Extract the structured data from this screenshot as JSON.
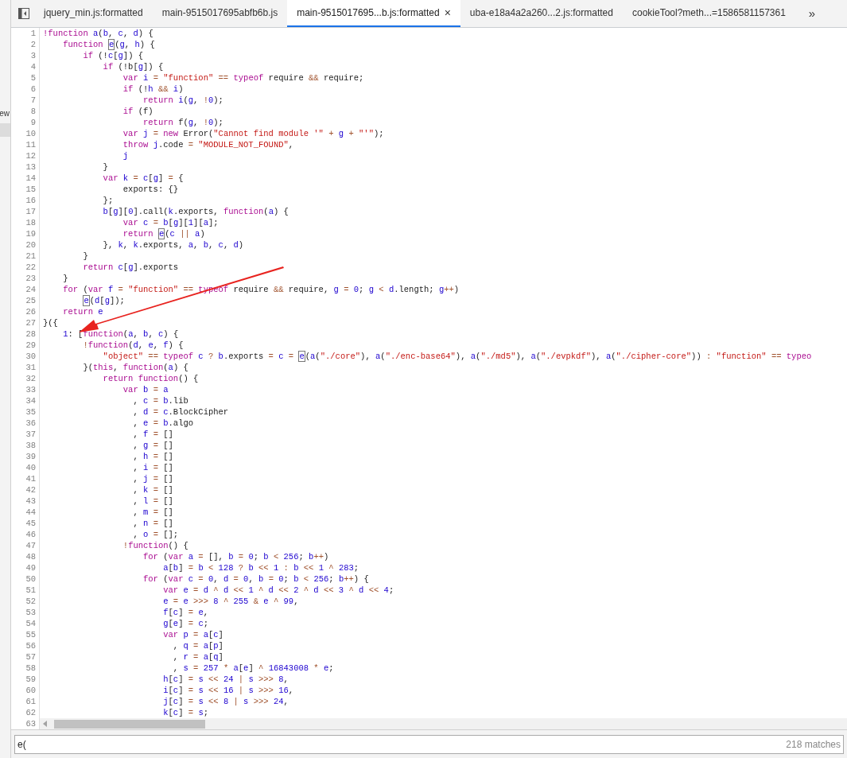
{
  "sidebar": {
    "label": "ew"
  },
  "tabs": [
    {
      "label": "jquery_min.js:formatted",
      "selected": false
    },
    {
      "label": "main-9515017695abfb6b.js",
      "selected": false
    },
    {
      "label": "main-9515017695...b.js:formatted",
      "selected": true
    },
    {
      "label": "uba-e18a4a2a260...2.js:formatted",
      "selected": false
    },
    {
      "label": "cookieTool?meth...=1586581157361",
      "selected": false
    }
  ],
  "tab_close": "×",
  "tab_overflow": "»",
  "lines": [
    {
      "number": "1",
      "tokens": [
        {
          "kind": "kw",
          "text": "!function"
        },
        {
          "kind": "var",
          "text": " a"
        },
        {
          "kind": "plain",
          "text": "("
        },
        {
          "kind": "var",
          "text": "b"
        },
        {
          "kind": "plain",
          "text": ","
        },
        {
          "kind": "var",
          "text": " c"
        },
        {
          "kind": "plain",
          "text": ","
        },
        {
          "kind": "var",
          "text": " d"
        },
        {
          "kind": "plain",
          "text": ") {"
        }
      ]
    },
    {
      "number": "2",
      "tokens": [
        {
          "kind": "kw",
          "text": "    function "
        },
        {
          "kind": "match",
          "text": "e"
        },
        {
          "kind": "plain",
          "text": "("
        },
        {
          "kind": "var",
          "text": "g"
        },
        {
          "kind": "plain",
          "text": ","
        },
        {
          "kind": "var",
          "text": " h"
        },
        {
          "kind": "plain",
          "text": ") {"
        }
      ]
    },
    {
      "number": "3",
      "tokens": [
        {
          "kind": "kw",
          "text": "        if"
        },
        {
          "kind": "plain",
          "text": " (!"
        },
        {
          "kind": "var",
          "text": "c"
        },
        {
          "kind": "plain",
          "text": "["
        },
        {
          "kind": "var",
          "text": "g"
        },
        {
          "kind": "plain",
          "text": "]) {"
        }
      ]
    },
    {
      "number": "4",
      "tokens": [
        {
          "kind": "kw",
          "text": "            if"
        },
        {
          "kind": "plain",
          "text": " (!b["
        },
        {
          "kind": "var",
          "text": "g"
        },
        {
          "kind": "plain",
          "text": "]) {"
        }
      ]
    },
    {
      "number": "5",
      "tokens": [
        {
          "kind": "kw",
          "text": "                var"
        },
        {
          "kind": "var",
          "text": " i"
        },
        {
          "kind": "op",
          "text": " ="
        },
        {
          "kind": "str",
          "text": " \"function\""
        },
        {
          "kind": "op",
          "text": " =="
        },
        {
          "kind": "kw",
          "text": " typeof"
        },
        {
          "kind": "plain",
          "text": " require"
        },
        {
          "kind": "op",
          "text": " &&"
        },
        {
          "kind": "plain",
          "text": " require;"
        }
      ]
    },
    {
      "number": "6",
      "tokens": [
        {
          "kind": "kw",
          "text": "                if"
        },
        {
          "kind": "plain",
          "text": " (!"
        },
        {
          "kind": "var",
          "text": "h"
        },
        {
          "kind": "op",
          "text": " &&"
        },
        {
          "kind": "var",
          "text": " i"
        },
        {
          "kind": "plain",
          "text": ")"
        }
      ]
    },
    {
      "number": "7",
      "tokens": [
        {
          "kind": "kw",
          "text": "                    return"
        },
        {
          "kind": "var",
          "text": " i"
        },
        {
          "kind": "plain",
          "text": "("
        },
        {
          "kind": "var",
          "text": "g"
        },
        {
          "kind": "plain",
          "text": ","
        },
        {
          "kind": "op",
          "text": " !"
        },
        {
          "kind": "num",
          "text": "0"
        },
        {
          "kind": "plain",
          "text": ");"
        }
      ]
    },
    {
      "number": "8",
      "tokens": [
        {
          "kind": "kw",
          "text": "                if"
        },
        {
          "kind": "plain",
          "text": " (f)"
        }
      ]
    },
    {
      "number": "9",
      "tokens": [
        {
          "kind": "kw",
          "text": "                    return"
        },
        {
          "kind": "plain",
          "text": " f("
        },
        {
          "kind": "var",
          "text": "g"
        },
        {
          "kind": "plain",
          "text": ","
        },
        {
          "kind": "op",
          "text": " !"
        },
        {
          "kind": "num",
          "text": "0"
        },
        {
          "kind": "plain",
          "text": ");"
        }
      ]
    },
    {
      "number": "10",
      "tokens": [
        {
          "kind": "kw",
          "text": "                var"
        },
        {
          "kind": "var",
          "text": " j"
        },
        {
          "kind": "op",
          "text": " ="
        },
        {
          "kind": "kw",
          "text": " new"
        },
        {
          "kind": "plain",
          "text": " Error("
        },
        {
          "kind": "str",
          "text": "\"Cannot find module '\""
        },
        {
          "kind": "op",
          "text": " +"
        },
        {
          "kind": "var",
          "text": " g"
        },
        {
          "kind": "op",
          "text": " +"
        },
        {
          "kind": "str",
          "text": " \"'\""
        },
        {
          "kind": "plain",
          "text": ");"
        }
      ]
    },
    {
      "number": "11",
      "tokens": [
        {
          "kind": "kw",
          "text": "                throw"
        },
        {
          "kind": "var",
          "text": " j"
        },
        {
          "kind": "plain",
          "text": ".code"
        },
        {
          "kind": "op",
          "text": " ="
        },
        {
          "kind": "str",
          "text": " \"MODULE_NOT_FOUND\""
        },
        {
          "kind": "plain",
          "text": ","
        }
      ]
    },
    {
      "number": "12",
      "tokens": [
        {
          "kind": "var",
          "text": "                j"
        }
      ]
    },
    {
      "number": "13",
      "tokens": [
        {
          "kind": "plain",
          "text": "            }"
        }
      ]
    },
    {
      "number": "14",
      "tokens": [
        {
          "kind": "kw",
          "text": "            var"
        },
        {
          "kind": "var",
          "text": " k"
        },
        {
          "kind": "op",
          "text": " ="
        },
        {
          "kind": "var",
          "text": " c"
        },
        {
          "kind": "plain",
          "text": "["
        },
        {
          "kind": "var",
          "text": "g"
        },
        {
          "kind": "plain",
          "text": "]"
        },
        {
          "kind": "op",
          "text": " ="
        },
        {
          "kind": "plain",
          "text": " {"
        }
      ]
    },
    {
      "number": "15",
      "tokens": [
        {
          "kind": "plain",
          "text": "                exports: {}"
        }
      ]
    },
    {
      "number": "16",
      "tokens": [
        {
          "kind": "plain",
          "text": "            };"
        }
      ]
    },
    {
      "number": "17",
      "tokens": [
        {
          "kind": "var",
          "text": "            b"
        },
        {
          "kind": "plain",
          "text": "["
        },
        {
          "kind": "var",
          "text": "g"
        },
        {
          "kind": "plain",
          "text": "]["
        },
        {
          "kind": "num",
          "text": "0"
        },
        {
          "kind": "plain",
          "text": "].call("
        },
        {
          "kind": "var",
          "text": "k"
        },
        {
          "kind": "plain",
          "text": ".exports,"
        },
        {
          "kind": "kw",
          "text": " function"
        },
        {
          "kind": "plain",
          "text": "("
        },
        {
          "kind": "var",
          "text": "a"
        },
        {
          "kind": "plain",
          "text": ") {"
        }
      ]
    },
    {
      "number": "18",
      "tokens": [
        {
          "kind": "kw",
          "text": "                var"
        },
        {
          "kind": "var",
          "text": " c"
        },
        {
          "kind": "op",
          "text": " ="
        },
        {
          "kind": "var",
          "text": " b"
        },
        {
          "kind": "plain",
          "text": "["
        },
        {
          "kind": "var",
          "text": "g"
        },
        {
          "kind": "plain",
          "text": "]["
        },
        {
          "kind": "num",
          "text": "1"
        },
        {
          "kind": "plain",
          "text": "]["
        },
        {
          "kind": "var",
          "text": "a"
        },
        {
          "kind": "plain",
          "text": "];"
        }
      ]
    },
    {
      "number": "19",
      "tokens": [
        {
          "kind": "kw",
          "text": "                return "
        },
        {
          "kind": "match",
          "text": "e"
        },
        {
          "kind": "plain",
          "text": "("
        },
        {
          "kind": "var",
          "text": "c"
        },
        {
          "kind": "op",
          "text": " ||"
        },
        {
          "kind": "var",
          "text": " a"
        },
        {
          "kind": "plain",
          "text": ")"
        }
      ]
    },
    {
      "number": "20",
      "tokens": [
        {
          "kind": "plain",
          "text": "            },"
        },
        {
          "kind": "var",
          "text": " k"
        },
        {
          "kind": "plain",
          "text": ","
        },
        {
          "kind": "var",
          "text": " k"
        },
        {
          "kind": "plain",
          "text": ".exports,"
        },
        {
          "kind": "var",
          "text": " a"
        },
        {
          "kind": "plain",
          "text": ","
        },
        {
          "kind": "var",
          "text": " b"
        },
        {
          "kind": "plain",
          "text": ","
        },
        {
          "kind": "var",
          "text": " c"
        },
        {
          "kind": "plain",
          "text": ","
        },
        {
          "kind": "var",
          "text": " d"
        },
        {
          "kind": "plain",
          "text": ")"
        }
      ]
    },
    {
      "number": "21",
      "tokens": [
        {
          "kind": "plain",
          "text": "        }"
        }
      ]
    },
    {
      "number": "22",
      "tokens": [
        {
          "kind": "kw",
          "text": "        return"
        },
        {
          "kind": "var",
          "text": " c"
        },
        {
          "kind": "plain",
          "text": "["
        },
        {
          "kind": "var",
          "text": "g"
        },
        {
          "kind": "plain",
          "text": "].exports"
        }
      ]
    },
    {
      "number": "23",
      "tokens": [
        {
          "kind": "plain",
          "text": "    }"
        }
      ]
    },
    {
      "number": "24",
      "tokens": [
        {
          "kind": "kw",
          "text": "    for"
        },
        {
          "kind": "plain",
          "text": " ("
        },
        {
          "kind": "kw",
          "text": "var"
        },
        {
          "kind": "var",
          "text": " f"
        },
        {
          "kind": "op",
          "text": " ="
        },
        {
          "kind": "str",
          "text": " \"function\""
        },
        {
          "kind": "op",
          "text": " =="
        },
        {
          "kind": "kw",
          "text": " typeof"
        },
        {
          "kind": "plain",
          "text": " require"
        },
        {
          "kind": "op",
          "text": " &&"
        },
        {
          "kind": "plain",
          "text": " require,"
        },
        {
          "kind": "var",
          "text": " g"
        },
        {
          "kind": "op",
          "text": " ="
        },
        {
          "kind": "num",
          "text": " 0"
        },
        {
          "kind": "plain",
          "text": ";"
        },
        {
          "kind": "var",
          "text": " g"
        },
        {
          "kind": "op",
          "text": " <"
        },
        {
          "kind": "var",
          "text": " d"
        },
        {
          "kind": "plain",
          "text": ".length;"
        },
        {
          "kind": "var",
          "text": " g"
        },
        {
          "kind": "op",
          "text": "++"
        },
        {
          "kind": "plain",
          "text": ")"
        }
      ]
    },
    {
      "number": "25",
      "tokens": [
        {
          "kind": "match",
          "text": "        e"
        },
        {
          "kind": "plain",
          "text": "("
        },
        {
          "kind": "var",
          "text": "d"
        },
        {
          "kind": "plain",
          "text": "["
        },
        {
          "kind": "var",
          "text": "g"
        },
        {
          "kind": "plain",
          "text": "]);"
        }
      ]
    },
    {
      "number": "26",
      "tokens": [
        {
          "kind": "kw",
          "text": "    return"
        },
        {
          "kind": "var",
          "text": " e"
        }
      ]
    },
    {
      "number": "27",
      "tokens": [
        {
          "kind": "plain",
          "text": "}({"
        }
      ]
    },
    {
      "number": "28",
      "tokens": [
        {
          "kind": "num",
          "text": "    1"
        },
        {
          "kind": "plain",
          "text": ": ["
        },
        {
          "kind": "kw",
          "text": "function"
        },
        {
          "kind": "plain",
          "text": "("
        },
        {
          "kind": "var",
          "text": "a"
        },
        {
          "kind": "plain",
          "text": ","
        },
        {
          "kind": "var",
          "text": " b"
        },
        {
          "kind": "plain",
          "text": ","
        },
        {
          "kind": "var",
          "text": " c"
        },
        {
          "kind": "plain",
          "text": ") {"
        }
      ]
    },
    {
      "number": "29",
      "tokens": [
        {
          "kind": "op",
          "text": "        !"
        },
        {
          "kind": "kw",
          "text": "function"
        },
        {
          "kind": "plain",
          "text": "("
        },
        {
          "kind": "var",
          "text": "d"
        },
        {
          "kind": "plain",
          "text": ","
        },
        {
          "kind": "var",
          "text": " e"
        },
        {
          "kind": "plain",
          "text": ","
        },
        {
          "kind": "var",
          "text": " f"
        },
        {
          "kind": "plain",
          "text": ") {"
        }
      ]
    },
    {
      "number": "30",
      "tokens": [
        {
          "kind": "str",
          "text": "            \"object\""
        },
        {
          "kind": "op",
          "text": " =="
        },
        {
          "kind": "kw",
          "text": " typeof"
        },
        {
          "kind": "var",
          "text": " c"
        },
        {
          "kind": "op",
          "text": " ?"
        },
        {
          "kind": "var",
          "text": " b"
        },
        {
          "kind": "plain",
          "text": ".exports"
        },
        {
          "kind": "op",
          "text": " ="
        },
        {
          "kind": "var",
          "text": " c"
        },
        {
          "kind": "op",
          "text": " = "
        },
        {
          "kind": "match",
          "text": "e"
        },
        {
          "kind": "plain",
          "text": "("
        },
        {
          "kind": "var",
          "text": "a"
        },
        {
          "kind": "plain",
          "text": "("
        },
        {
          "kind": "str",
          "text": "\"./core\""
        },
        {
          "kind": "plain",
          "text": "),"
        },
        {
          "kind": "var",
          "text": " a"
        },
        {
          "kind": "plain",
          "text": "("
        },
        {
          "kind": "str",
          "text": "\"./enc-base64\""
        },
        {
          "kind": "plain",
          "text": "),"
        },
        {
          "kind": "var",
          "text": " a"
        },
        {
          "kind": "plain",
          "text": "("
        },
        {
          "kind": "str",
          "text": "\"./md5\""
        },
        {
          "kind": "plain",
          "text": "),"
        },
        {
          "kind": "var",
          "text": " a"
        },
        {
          "kind": "plain",
          "text": "("
        },
        {
          "kind": "str",
          "text": "\"./evpkdf\""
        },
        {
          "kind": "plain",
          "text": "),"
        },
        {
          "kind": "var",
          "text": " a"
        },
        {
          "kind": "plain",
          "text": "("
        },
        {
          "kind": "str",
          "text": "\"./cipher-core\""
        },
        {
          "kind": "plain",
          "text": "))"
        },
        {
          "kind": "op",
          "text": " :"
        },
        {
          "kind": "str",
          "text": " \"function\""
        },
        {
          "kind": "op",
          "text": " =="
        },
        {
          "kind": "kw",
          "text": " typeo"
        }
      ]
    },
    {
      "number": "31",
      "tokens": [
        {
          "kind": "plain",
          "text": "        }("
        },
        {
          "kind": "kw",
          "text": "this"
        },
        {
          "kind": "plain",
          "text": ","
        },
        {
          "kind": "kw",
          "text": " function"
        },
        {
          "kind": "plain",
          "text": "("
        },
        {
          "kind": "var",
          "text": "a"
        },
        {
          "kind": "plain",
          "text": ") {"
        }
      ]
    },
    {
      "number": "32",
      "tokens": [
        {
          "kind": "kw",
          "text": "            return function"
        },
        {
          "kind": "plain",
          "text": "() {"
        }
      ]
    },
    {
      "number": "33",
      "tokens": [
        {
          "kind": "kw",
          "text": "                var"
        },
        {
          "kind": "var",
          "text": " b"
        },
        {
          "kind": "op",
          "text": " ="
        },
        {
          "kind": "var",
          "text": " a"
        }
      ]
    },
    {
      "number": "34",
      "tokens": [
        {
          "kind": "plain",
          "text": "                  ,"
        },
        {
          "kind": "var",
          "text": " c"
        },
        {
          "kind": "op",
          "text": " ="
        },
        {
          "kind": "var",
          "text": " b"
        },
        {
          "kind": "plain",
          "text": ".lib"
        }
      ]
    },
    {
      "number": "35",
      "tokens": [
        {
          "kind": "plain",
          "text": "                  ,"
        },
        {
          "kind": "var",
          "text": " d"
        },
        {
          "kind": "op",
          "text": " ="
        },
        {
          "kind": "var",
          "text": " c"
        },
        {
          "kind": "plain",
          "text": ".BlockCipher"
        }
      ]
    },
    {
      "number": "36",
      "tokens": [
        {
          "kind": "plain",
          "text": "                  ,"
        },
        {
          "kind": "var",
          "text": " e"
        },
        {
          "kind": "op",
          "text": " ="
        },
        {
          "kind": "var",
          "text": " b"
        },
        {
          "kind": "plain",
          "text": ".algo"
        }
      ]
    },
    {
      "number": "37",
      "tokens": [
        {
          "kind": "plain",
          "text": "                  ,"
        },
        {
          "kind": "var",
          "text": " f"
        },
        {
          "kind": "op",
          "text": " ="
        },
        {
          "kind": "plain",
          "text": " []"
        }
      ]
    },
    {
      "number": "38",
      "tokens": [
        {
          "kind": "plain",
          "text": "                  ,"
        },
        {
          "kind": "var",
          "text": " g"
        },
        {
          "kind": "op",
          "text": " ="
        },
        {
          "kind": "plain",
          "text": " []"
        }
      ]
    },
    {
      "number": "39",
      "tokens": [
        {
          "kind": "plain",
          "text": "                  ,"
        },
        {
          "kind": "var",
          "text": " h"
        },
        {
          "kind": "op",
          "text": " ="
        },
        {
          "kind": "plain",
          "text": " []"
        }
      ]
    },
    {
      "number": "40",
      "tokens": [
        {
          "kind": "plain",
          "text": "                  ,"
        },
        {
          "kind": "var",
          "text": " i"
        },
        {
          "kind": "op",
          "text": " ="
        },
        {
          "kind": "plain",
          "text": " []"
        }
      ]
    },
    {
      "number": "41",
      "tokens": [
        {
          "kind": "plain",
          "text": "                  ,"
        },
        {
          "kind": "var",
          "text": " j"
        },
        {
          "kind": "op",
          "text": " ="
        },
        {
          "kind": "plain",
          "text": " []"
        }
      ]
    },
    {
      "number": "42",
      "tokens": [
        {
          "kind": "plain",
          "text": "                  ,"
        },
        {
          "kind": "var",
          "text": " k"
        },
        {
          "kind": "op",
          "text": " ="
        },
        {
          "kind": "plain",
          "text": " []"
        }
      ]
    },
    {
      "number": "43",
      "tokens": [
        {
          "kind": "plain",
          "text": "                  ,"
        },
        {
          "kind": "var",
          "text": " l"
        },
        {
          "kind": "op",
          "text": " ="
        },
        {
          "kind": "plain",
          "text": " []"
        }
      ]
    },
    {
      "number": "44",
      "tokens": [
        {
          "kind": "plain",
          "text": "                  ,"
        },
        {
          "kind": "var",
          "text": " m"
        },
        {
          "kind": "op",
          "text": " ="
        },
        {
          "kind": "plain",
          "text": " []"
        }
      ]
    },
    {
      "number": "45",
      "tokens": [
        {
          "kind": "plain",
          "text": "                  ,"
        },
        {
          "kind": "var",
          "text": " n"
        },
        {
          "kind": "op",
          "text": " ="
        },
        {
          "kind": "plain",
          "text": " []"
        }
      ]
    },
    {
      "number": "46",
      "tokens": [
        {
          "kind": "plain",
          "text": "                  ,"
        },
        {
          "kind": "var",
          "text": " o"
        },
        {
          "kind": "op",
          "text": " ="
        },
        {
          "kind": "plain",
          "text": " [];"
        }
      ]
    },
    {
      "number": "47",
      "tokens": [
        {
          "kind": "op",
          "text": "                !"
        },
        {
          "kind": "kw",
          "text": "function"
        },
        {
          "kind": "plain",
          "text": "() {"
        }
      ]
    },
    {
      "number": "48",
      "tokens": [
        {
          "kind": "kw",
          "text": "                    for"
        },
        {
          "kind": "plain",
          "text": " ("
        },
        {
          "kind": "kw",
          "text": "var"
        },
        {
          "kind": "var",
          "text": " a"
        },
        {
          "kind": "op",
          "text": " ="
        },
        {
          "kind": "plain",
          "text": " [],"
        },
        {
          "kind": "var",
          "text": " b"
        },
        {
          "kind": "op",
          "text": " ="
        },
        {
          "kind": "num",
          "text": " 0"
        },
        {
          "kind": "plain",
          "text": ";"
        },
        {
          "kind": "var",
          "text": " b"
        },
        {
          "kind": "op",
          "text": " <"
        },
        {
          "kind": "num",
          "text": " 256"
        },
        {
          "kind": "plain",
          "text": ";"
        },
        {
          "kind": "var",
          "text": " b"
        },
        {
          "kind": "op",
          "text": "++"
        },
        {
          "kind": "plain",
          "text": ")"
        }
      ]
    },
    {
      "number": "49",
      "tokens": [
        {
          "kind": "var",
          "text": "                        a"
        },
        {
          "kind": "plain",
          "text": "["
        },
        {
          "kind": "var",
          "text": "b"
        },
        {
          "kind": "plain",
          "text": "]"
        },
        {
          "kind": "op",
          "text": " ="
        },
        {
          "kind": "var",
          "text": " b"
        },
        {
          "kind": "op",
          "text": " <"
        },
        {
          "kind": "num",
          "text": " 128"
        },
        {
          "kind": "op",
          "text": " ?"
        },
        {
          "kind": "var",
          "text": " b"
        },
        {
          "kind": "op",
          "text": " <<"
        },
        {
          "kind": "num",
          "text": " 1"
        },
        {
          "kind": "op",
          "text": " :"
        },
        {
          "kind": "var",
          "text": " b"
        },
        {
          "kind": "op",
          "text": " <<"
        },
        {
          "kind": "num",
          "text": " 1"
        },
        {
          "kind": "op",
          "text": " ^"
        },
        {
          "kind": "num",
          "text": " 283"
        },
        {
          "kind": "plain",
          "text": ";"
        }
      ]
    },
    {
      "number": "50",
      "tokens": [
        {
          "kind": "kw",
          "text": "                    for"
        },
        {
          "kind": "plain",
          "text": " ("
        },
        {
          "kind": "kw",
          "text": "var"
        },
        {
          "kind": "var",
          "text": " c"
        },
        {
          "kind": "op",
          "text": " ="
        },
        {
          "kind": "num",
          "text": " 0"
        },
        {
          "kind": "plain",
          "text": ","
        },
        {
          "kind": "var",
          "text": " d"
        },
        {
          "kind": "op",
          "text": " ="
        },
        {
          "kind": "num",
          "text": " 0"
        },
        {
          "kind": "plain",
          "text": ","
        },
        {
          "kind": "var",
          "text": " b"
        },
        {
          "kind": "op",
          "text": " ="
        },
        {
          "kind": "num",
          "text": " 0"
        },
        {
          "kind": "plain",
          "text": ";"
        },
        {
          "kind": "var",
          "text": " b"
        },
        {
          "kind": "op",
          "text": " <"
        },
        {
          "kind": "num",
          "text": " 256"
        },
        {
          "kind": "plain",
          "text": ";"
        },
        {
          "kind": "var",
          "text": " b"
        },
        {
          "kind": "op",
          "text": "++"
        },
        {
          "kind": "plain",
          "text": ") {"
        }
      ]
    },
    {
      "number": "51",
      "tokens": [
        {
          "kind": "kw",
          "text": "                        var"
        },
        {
          "kind": "var",
          "text": " e"
        },
        {
          "kind": "op",
          "text": " ="
        },
        {
          "kind": "var",
          "text": " d"
        },
        {
          "kind": "op",
          "text": " ^"
        },
        {
          "kind": "var",
          "text": " d"
        },
        {
          "kind": "op",
          "text": " <<"
        },
        {
          "kind": "num",
          "text": " 1"
        },
        {
          "kind": "op",
          "text": " ^"
        },
        {
          "kind": "var",
          "text": " d"
        },
        {
          "kind": "op",
          "text": " <<"
        },
        {
          "kind": "num",
          "text": " 2"
        },
        {
          "kind": "op",
          "text": " ^"
        },
        {
          "kind": "var",
          "text": " d"
        },
        {
          "kind": "op",
          "text": " <<"
        },
        {
          "kind": "num",
          "text": " 3"
        },
        {
          "kind": "op",
          "text": " ^"
        },
        {
          "kind": "var",
          "text": " d"
        },
        {
          "kind": "op",
          "text": " <<"
        },
        {
          "kind": "num",
          "text": " 4"
        },
        {
          "kind": "plain",
          "text": ";"
        }
      ]
    },
    {
      "number": "52",
      "tokens": [
        {
          "kind": "var",
          "text": "                        e"
        },
        {
          "kind": "op",
          "text": " ="
        },
        {
          "kind": "var",
          "text": " e"
        },
        {
          "kind": "op",
          "text": " >>>"
        },
        {
          "kind": "num",
          "text": " 8"
        },
        {
          "kind": "op",
          "text": " ^"
        },
        {
          "kind": "num",
          "text": " 255"
        },
        {
          "kind": "op",
          "text": " &"
        },
        {
          "kind": "var",
          "text": " e"
        },
        {
          "kind": "op",
          "text": " ^"
        },
        {
          "kind": "num",
          "text": " 99"
        },
        {
          "kind": "plain",
          "text": ","
        }
      ]
    },
    {
      "number": "53",
      "tokens": [
        {
          "kind": "var",
          "text": "                        f"
        },
        {
          "kind": "plain",
          "text": "["
        },
        {
          "kind": "var",
          "text": "c"
        },
        {
          "kind": "plain",
          "text": "]"
        },
        {
          "kind": "op",
          "text": " ="
        },
        {
          "kind": "var",
          "text": " e"
        },
        {
          "kind": "plain",
          "text": ","
        }
      ]
    },
    {
      "number": "54",
      "tokens": [
        {
          "kind": "var",
          "text": "                        g"
        },
        {
          "kind": "plain",
          "text": "["
        },
        {
          "kind": "var",
          "text": "e"
        },
        {
          "kind": "plain",
          "text": "]"
        },
        {
          "kind": "op",
          "text": " ="
        },
        {
          "kind": "var",
          "text": " c"
        },
        {
          "kind": "plain",
          "text": ";"
        }
      ]
    },
    {
      "number": "55",
      "tokens": [
        {
          "kind": "kw",
          "text": "                        var"
        },
        {
          "kind": "var",
          "text": " p"
        },
        {
          "kind": "op",
          "text": " ="
        },
        {
          "kind": "var",
          "text": " a"
        },
        {
          "kind": "plain",
          "text": "["
        },
        {
          "kind": "var",
          "text": "c"
        },
        {
          "kind": "plain",
          "text": "]"
        }
      ]
    },
    {
      "number": "56",
      "tokens": [
        {
          "kind": "plain",
          "text": "                          ,"
        },
        {
          "kind": "var",
          "text": " q"
        },
        {
          "kind": "op",
          "text": " ="
        },
        {
          "kind": "var",
          "text": " a"
        },
        {
          "kind": "plain",
          "text": "["
        },
        {
          "kind": "var",
          "text": "p"
        },
        {
          "kind": "plain",
          "text": "]"
        }
      ]
    },
    {
      "number": "57",
      "tokens": [
        {
          "kind": "plain",
          "text": "                          ,"
        },
        {
          "kind": "var",
          "text": " r"
        },
        {
          "kind": "op",
          "text": " ="
        },
        {
          "kind": "var",
          "text": " a"
        },
        {
          "kind": "plain",
          "text": "["
        },
        {
          "kind": "var",
          "text": "q"
        },
        {
          "kind": "plain",
          "text": "]"
        }
      ]
    },
    {
      "number": "58",
      "tokens": [
        {
          "kind": "plain",
          "text": "                          ,"
        },
        {
          "kind": "var",
          "text": " s"
        },
        {
          "kind": "op",
          "text": " ="
        },
        {
          "kind": "num",
          "text": " 257"
        },
        {
          "kind": "op",
          "text": " *"
        },
        {
          "kind": "var",
          "text": " a"
        },
        {
          "kind": "plain",
          "text": "["
        },
        {
          "kind": "var",
          "text": "e"
        },
        {
          "kind": "plain",
          "text": "]"
        },
        {
          "kind": "op",
          "text": " ^"
        },
        {
          "kind": "num",
          "text": " 16843008"
        },
        {
          "kind": "op",
          "text": " *"
        },
        {
          "kind": "var",
          "text": " e"
        },
        {
          "kind": "plain",
          "text": ";"
        }
      ]
    },
    {
      "number": "59",
      "tokens": [
        {
          "kind": "var",
          "text": "                        h"
        },
        {
          "kind": "plain",
          "text": "["
        },
        {
          "kind": "var",
          "text": "c"
        },
        {
          "kind": "plain",
          "text": "]"
        },
        {
          "kind": "op",
          "text": " ="
        },
        {
          "kind": "var",
          "text": " s"
        },
        {
          "kind": "op",
          "text": " <<"
        },
        {
          "kind": "num",
          "text": " 24"
        },
        {
          "kind": "op",
          "text": " |"
        },
        {
          "kind": "var",
          "text": " s"
        },
        {
          "kind": "op",
          "text": " >>>"
        },
        {
          "kind": "num",
          "text": " 8"
        },
        {
          "kind": "plain",
          "text": ","
        }
      ]
    },
    {
      "number": "60",
      "tokens": [
        {
          "kind": "var",
          "text": "                        i"
        },
        {
          "kind": "plain",
          "text": "["
        },
        {
          "kind": "var",
          "text": "c"
        },
        {
          "kind": "plain",
          "text": "]"
        },
        {
          "kind": "op",
          "text": " ="
        },
        {
          "kind": "var",
          "text": " s"
        },
        {
          "kind": "op",
          "text": " <<"
        },
        {
          "kind": "num",
          "text": " 16"
        },
        {
          "kind": "op",
          "text": " |"
        },
        {
          "kind": "var",
          "text": " s"
        },
        {
          "kind": "op",
          "text": " >>>"
        },
        {
          "kind": "num",
          "text": " 16"
        },
        {
          "kind": "plain",
          "text": ","
        }
      ]
    },
    {
      "number": "61",
      "tokens": [
        {
          "kind": "var",
          "text": "                        j"
        },
        {
          "kind": "plain",
          "text": "["
        },
        {
          "kind": "var",
          "text": "c"
        },
        {
          "kind": "plain",
          "text": "]"
        },
        {
          "kind": "op",
          "text": " ="
        },
        {
          "kind": "var",
          "text": " s"
        },
        {
          "kind": "op",
          "text": " <<"
        },
        {
          "kind": "num",
          "text": " 8"
        },
        {
          "kind": "op",
          "text": " |"
        },
        {
          "kind": "var",
          "text": " s"
        },
        {
          "kind": "op",
          "text": " >>>"
        },
        {
          "kind": "num",
          "text": " 24"
        },
        {
          "kind": "plain",
          "text": ","
        }
      ]
    },
    {
      "number": "62",
      "tokens": [
        {
          "kind": "var",
          "text": "                        k"
        },
        {
          "kind": "plain",
          "text": "["
        },
        {
          "kind": "var",
          "text": "c"
        },
        {
          "kind": "plain",
          "text": "]"
        },
        {
          "kind": "op",
          "text": " ="
        },
        {
          "kind": "var",
          "text": " s"
        },
        {
          "kind": "plain",
          "text": ";"
        }
      ]
    },
    {
      "number": "63"
    }
  ],
  "search": {
    "value": "e(",
    "matches": "218 matches"
  }
}
